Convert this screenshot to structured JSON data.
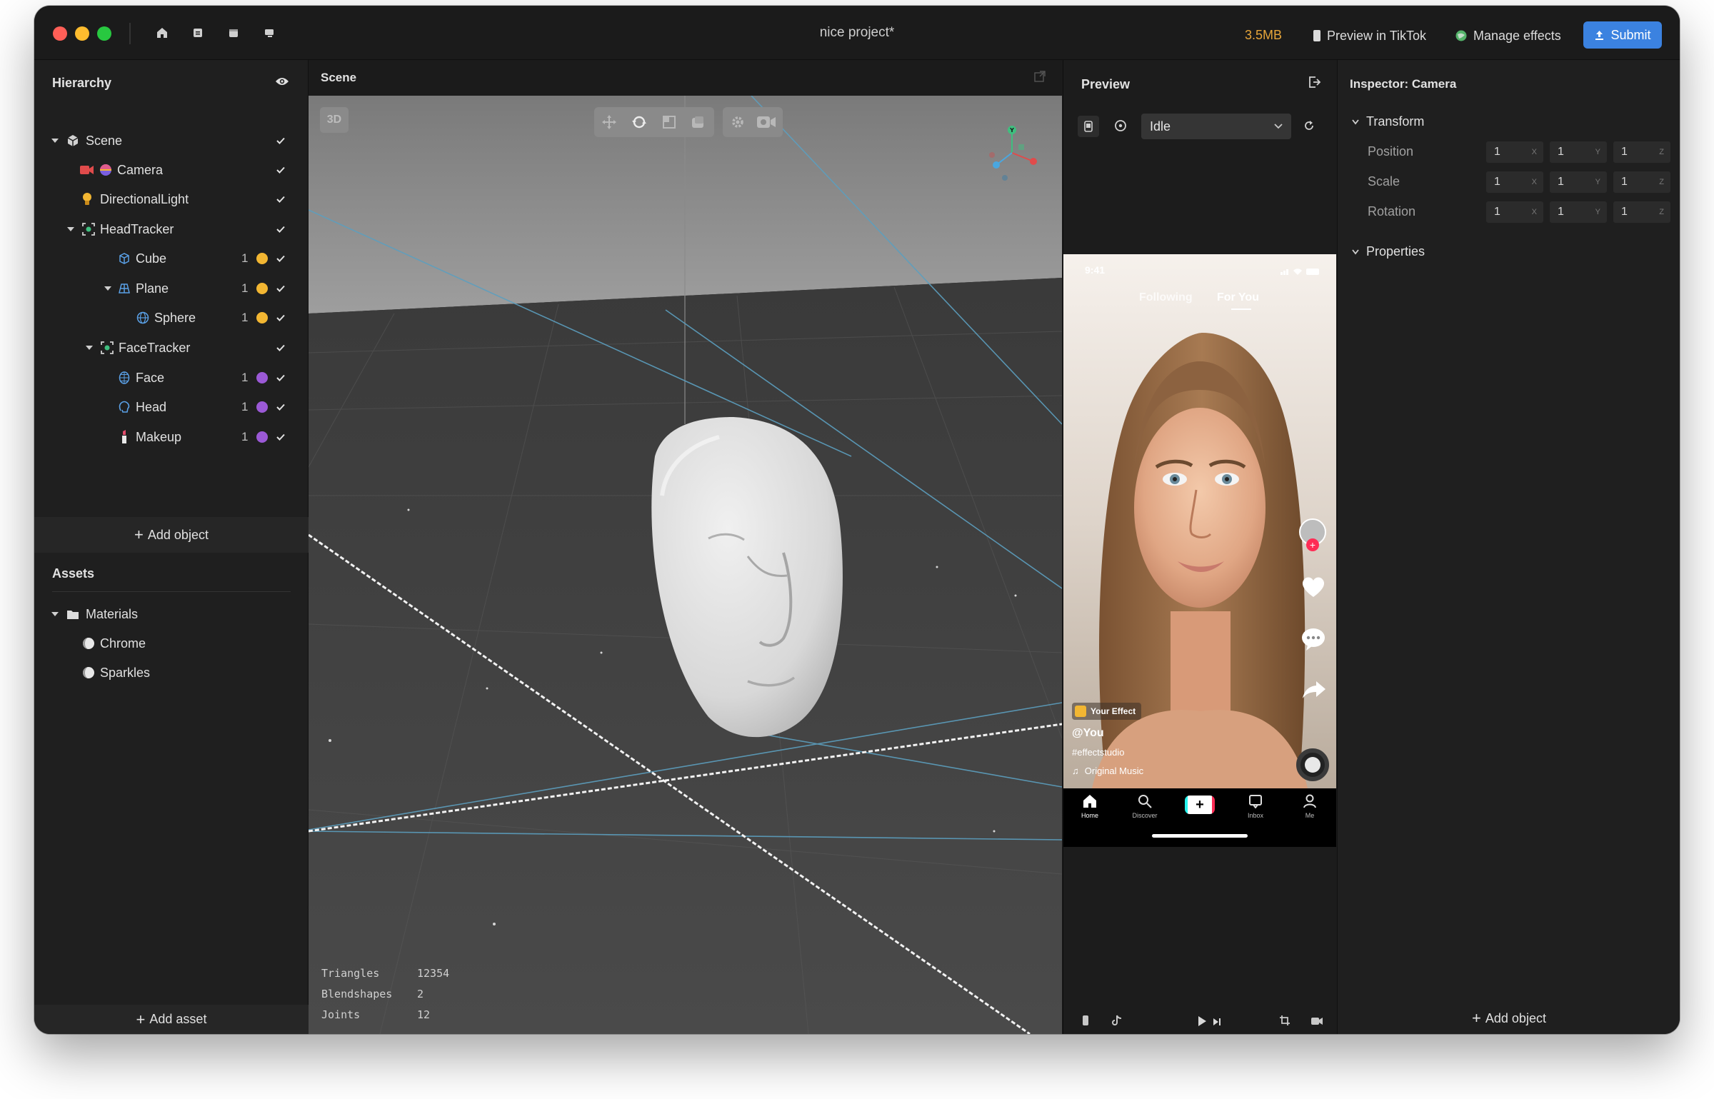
{
  "titlebar": {
    "project_title": "nice project*",
    "file_size": "3.5MB",
    "preview_label": "Preview in TikTok",
    "manage_label": "Manage effects",
    "submit_label": "Submit"
  },
  "hierarchy": {
    "title": "Hierarchy",
    "items": [
      {
        "label": "Scene",
        "icon": "scene-icon"
      },
      {
        "label": "Camera",
        "icon": "camera-icon"
      },
      {
        "label": "DirectionalLight",
        "icon": "light-bulb-icon"
      },
      {
        "label": "HeadTracker",
        "icon": "tracker-icon"
      },
      {
        "label": "Cube",
        "icon": "cube-icon",
        "count": "1",
        "dot_color": "#f2b632"
      },
      {
        "label": "Plane",
        "icon": "plane-icon",
        "count": "1",
        "dot_color": "#f2b632"
      },
      {
        "label": "Sphere",
        "icon": "sphere-icon",
        "count": "1",
        "dot_color": "#f2b632"
      },
      {
        "label": "FaceTracker",
        "icon": "tracker-icon"
      },
      {
        "label": "Face",
        "icon": "face-mesh-icon",
        "count": "1",
        "dot_color": "#9b59d6"
      },
      {
        "label": "Head",
        "icon": "head-icon",
        "count": "1",
        "dot_color": "#9b59d6"
      },
      {
        "label": "Makeup",
        "icon": "lipstick-icon",
        "count": "1",
        "dot_color": "#9b59d6"
      }
    ],
    "add_object": "Add object"
  },
  "assets": {
    "title": "Assets",
    "items": [
      {
        "label": "Materials",
        "icon": "folder-icon"
      },
      {
        "label": "Chrome",
        "icon": "material-icon"
      },
      {
        "label": "Sparkles",
        "icon": "material-icon"
      }
    ],
    "add_asset": "Add asset"
  },
  "scene": {
    "title": "Scene",
    "mode_badge": "3D",
    "stats": [
      {
        "label": "Triangles",
        "value": "12354"
      },
      {
        "label": "Blendshapes",
        "value": "2"
      },
      {
        "label": "Joints",
        "value": "12"
      }
    ],
    "gizmo_y": "Y"
  },
  "preview": {
    "title": "Preview",
    "state_value": "Idle",
    "phone": {
      "time": "9:41",
      "tab_following": "Following",
      "tab_foryou": "For You",
      "effect_badge": "Your Effect",
      "username": "@You",
      "hashtag": "#effectstudio",
      "music": "Original Music",
      "nav": [
        "Home",
        "Discover",
        "",
        "Inbox",
        "Me"
      ]
    }
  },
  "inspector": {
    "title": "Inspector: Camera",
    "transform_label": "Transform",
    "rows": [
      {
        "label": "Position",
        "x": "1",
        "y": "1",
        "z": "1"
      },
      {
        "label": "Scale",
        "x": "1",
        "y": "1",
        "z": "1"
      },
      {
        "label": "Rotation",
        "x": "1",
        "y": "1",
        "z": "1"
      }
    ],
    "axis_x": "X",
    "axis_y": "Y",
    "axis_z": "Z",
    "properties_label": "Properties",
    "add_object": "Add object"
  },
  "colors": {
    "accent": "#3b82e0",
    "file_size": "#e6a53a",
    "dot_yellow": "#f2b632",
    "dot_purple": "#9b59d6"
  }
}
